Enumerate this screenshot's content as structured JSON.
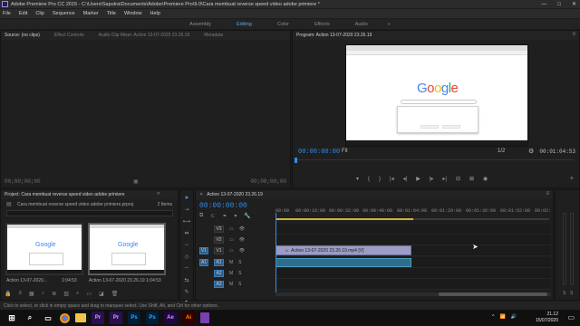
{
  "window": {
    "title": "Adobe Premiere Pro CC 2015 - C:\\Users\\Saputra\\Documents\\Adobe\\Premiere Pro\\9.0\\Cara membuat reverse speed video adobe primiere *",
    "minimize": "—",
    "maximize": "□",
    "close": "✕"
  },
  "menu": [
    "File",
    "Edit",
    "Clip",
    "Sequence",
    "Marker",
    "Title",
    "Window",
    "Help"
  ],
  "workspaces": {
    "items": [
      "Assembly",
      "Editing",
      "Color",
      "Effects",
      "Audio"
    ],
    "active": "Editing",
    "more": "»"
  },
  "source_panel": {
    "tabs": [
      "Source: (no clips)",
      "Effect Controls",
      "Audio Clip Mixer: Action 13-07-2020 23.26.19",
      "Metadata"
    ],
    "timecode_left": "00;00;00;00",
    "timecode_right": "00;00;00;00"
  },
  "program_panel": {
    "tab": "Program: Action 13-07-2020 23.26.19",
    "timecode": "00:00:00:00",
    "fit": "Fit",
    "ratio": "1/2",
    "duration": "00:01:04:53",
    "screen": {
      "logo": "Google",
      "logo_colors": [
        "#4285f4",
        "#ea4335",
        "#fbbc05",
        "#4285f4",
        "#34a853",
        "#ea4335"
      ]
    }
  },
  "project_panel": {
    "tab": "Project: Cara membuat reverse speed video adobe primiere",
    "file": "Cara membuat reverse speed video adobe primiere.prproj",
    "items_count": "2 Items",
    "items": [
      {
        "name": "Action 13-07-2020...",
        "duration": "1:04:53"
      },
      {
        "name": "Action 13-07-2020 23.26.19",
        "duration": "1:04:53"
      }
    ],
    "thumb_logo": "Google"
  },
  "timeline_panel": {
    "tab": "Action 13-07-2020 23.26.19",
    "timecode": "00:00:00:00",
    "ruler": [
      "00:00",
      "00:00:16:00",
      "00:00:32:00",
      "00:00:48:00",
      "00:01:04:00",
      "00:01:20:00",
      "00:01:36:00",
      "00:01:52:00",
      "00:02:"
    ],
    "video_tracks": [
      "V3",
      "V2",
      "V1"
    ],
    "audio_tracks": [
      "A1",
      "A2",
      "A3"
    ],
    "clip_name": "Action 13-07-2020 23.26.19.mp4 [V]",
    "fx_label": "fx"
  },
  "status_bar": {
    "text": "Click to select, or click in empty space and drag to marquee select. Use Shift, Alt, and Ctrl for other options."
  },
  "taskbar": {
    "time": "21.12",
    "date": "15/07/2020",
    "apps": [
      {
        "label": "Pr",
        "color": "#2a0f50"
      },
      {
        "label": "Pr",
        "color": "#2a0f50"
      },
      {
        "label": "Ps",
        "color": "#001e36"
      },
      {
        "label": "Ps",
        "color": "#001e36"
      },
      {
        "label": "Ae",
        "color": "#1f0740"
      },
      {
        "label": "Ai",
        "color": "#330000"
      }
    ]
  }
}
